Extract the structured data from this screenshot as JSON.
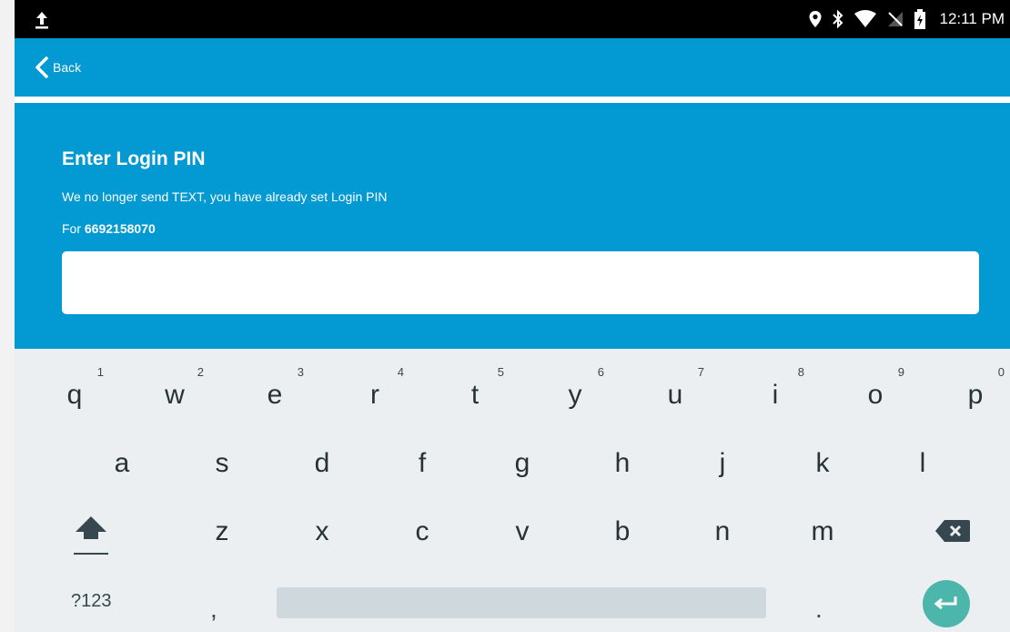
{
  "status_bar": {
    "time": "12:11 PM",
    "icons": [
      "upload-icon",
      "location-icon",
      "bluetooth-icon",
      "wifi-icon",
      "no-signal-icon",
      "battery-charging-icon"
    ]
  },
  "app_bar": {
    "back_label": "Back",
    "background": "#0399d2"
  },
  "login": {
    "title": "Enter Login PIN",
    "message": "We no longer send TEXT, you have already set Login PIN",
    "for_label": "For",
    "phone": "6692158070",
    "pin_value": ""
  },
  "keyboard": {
    "row1": [
      {
        "key": "q",
        "hint": "1"
      },
      {
        "key": "w",
        "hint": "2"
      },
      {
        "key": "e",
        "hint": "3"
      },
      {
        "key": "r",
        "hint": "4"
      },
      {
        "key": "t",
        "hint": "5"
      },
      {
        "key": "y",
        "hint": "6"
      },
      {
        "key": "u",
        "hint": "7"
      },
      {
        "key": "i",
        "hint": "8"
      },
      {
        "key": "o",
        "hint": "9"
      },
      {
        "key": "p",
        "hint": "0"
      }
    ],
    "row2": [
      "a",
      "s",
      "d",
      "f",
      "g",
      "h",
      "j",
      "k",
      "l"
    ],
    "row3": [
      "z",
      "x",
      "c",
      "v",
      "b",
      "n",
      "m"
    ],
    "symbols_label": "?123",
    "comma": ",",
    "period": ".",
    "enter_color": "#4db6ac"
  }
}
